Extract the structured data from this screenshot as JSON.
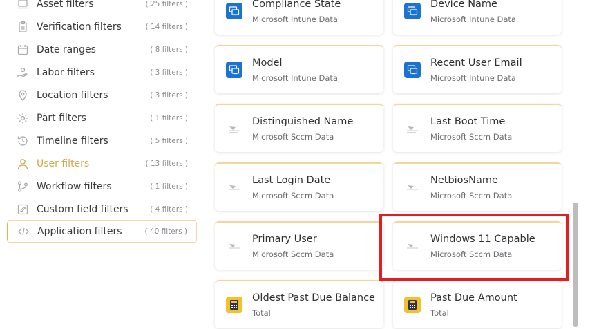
{
  "sidebar": {
    "items": [
      {
        "label": "Asset filters",
        "count": "( 25 filters )",
        "icon": "laptop-icon"
      },
      {
        "label": "Verification filters",
        "count": "( 14 filters )",
        "icon": "clipboard-icon"
      },
      {
        "label": "Date ranges",
        "count": "( 8 filters )",
        "icon": "calendar-icon"
      },
      {
        "label": "Labor filters",
        "count": "( 3 filters )",
        "icon": "hand-icon"
      },
      {
        "label": "Location filters",
        "count": "( 3 filters )",
        "icon": "location-pin-icon"
      },
      {
        "label": "Part filters",
        "count": "( 1 filters )",
        "icon": "gear-icon"
      },
      {
        "label": "Timeline filters",
        "count": "( 5 filters )",
        "icon": "history-icon"
      },
      {
        "label": "User filters",
        "count": "( 13 filters )",
        "icon": "user-icon"
      },
      {
        "label": "Workflow filters",
        "count": "( 1 filters )",
        "icon": "workflow-icon"
      },
      {
        "label": "Custom field filters",
        "count": "( 4 filters )",
        "icon": "edit-icon"
      },
      {
        "label": "Application filters",
        "count": "( 40 filters )",
        "icon": "code-icon"
      }
    ],
    "highlighted_item": "User filters",
    "selected_item": "Application filters"
  },
  "cards": [
    {
      "title": "Compliance State",
      "source": "Microsoft Intune Data",
      "icon": "intune-icon"
    },
    {
      "title": "Device Name",
      "source": "Microsoft Intune Data",
      "icon": "intune-icon"
    },
    {
      "title": "Model",
      "source": "Microsoft Intune Data",
      "icon": "intune-icon"
    },
    {
      "title": "Recent User Email",
      "source": "Microsoft Intune Data",
      "icon": "intune-icon"
    },
    {
      "title": "Distinguished Name",
      "source": "Microsoft Sccm Data",
      "icon": "sccm-icon"
    },
    {
      "title": "Last Boot Time",
      "source": "Microsoft Sccm Data",
      "icon": "sccm-icon"
    },
    {
      "title": "Last Login Date",
      "source": "Microsoft Sccm Data",
      "icon": "sccm-icon"
    },
    {
      "title": "NetbiosName",
      "source": "Microsoft Sccm Data",
      "icon": "sccm-icon"
    },
    {
      "title": "Primary User",
      "source": "Microsoft Sccm Data",
      "icon": "sccm-icon"
    },
    {
      "title": "Windows 11 Capable",
      "source": "Microsoft Sccm Data",
      "icon": "sccm-icon"
    },
    {
      "title": "Oldest Past Due Balance",
      "source": "Total",
      "icon": "calculator-icon"
    },
    {
      "title": "Past Due Amount",
      "source": "Total",
      "icon": "calculator-icon"
    }
  ],
  "highlighted_card": "Windows 11 Capable",
  "colors": {
    "accent": "#e2b54f",
    "intune_blue": "#1a73d2",
    "calculator_yellow": "#f3c12b",
    "highlight_red": "#e21e23"
  }
}
